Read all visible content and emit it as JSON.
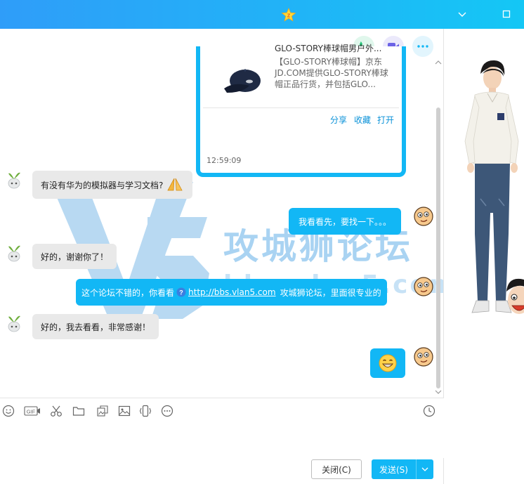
{
  "app": {
    "brand_color": "#12b7f5",
    "title_icon": "qq-zone-star-icon"
  },
  "titlebar": {
    "controls": [
      "chevron-down-icon",
      "maximize-icon"
    ]
  },
  "header_actions": [
    {
      "name": "phone-call-button",
      "icon": "phone-icon",
      "color": "#20c97a"
    },
    {
      "name": "video-call-button",
      "icon": "video-camera-icon",
      "color": "#6c63e6"
    },
    {
      "name": "more-button",
      "icon": "more-dots-icon",
      "color": "#12b7f5"
    }
  ],
  "card": {
    "title": "GLO-STORY棒球帽男户外...",
    "description_lines": [
      "【GLO-STORY棒球帽】京东",
      "JD.COM提供GLO-STORY棒球",
      "帽正品行货，并包括GLO..."
    ],
    "actions": [
      "分享",
      "收藏",
      "打开"
    ]
  },
  "timestamp": "12:59:09",
  "messages": [
    {
      "side": "left",
      "text": "有没有华为的模拟器与学习文档?",
      "emoji": "prayer-hands-icon"
    },
    {
      "side": "right",
      "text": "我看看先，要找一下。。。"
    },
    {
      "side": "left",
      "text": "好的，谢谢你了！"
    },
    {
      "side": "right",
      "text_before": "这个论坛不错的，你看看",
      "link": "http://bbs.vlan5.com",
      "text_after": "攻城狮论坛，里面很专业的"
    },
    {
      "side": "left",
      "text": "好的，我去看看，非常感谢！"
    },
    {
      "side": "right",
      "emoji": "grin-face-icon"
    }
  ],
  "watermark": {
    "text": "攻城狮论坛",
    "url": "bbs.vlan5.com"
  },
  "toolbar_icons": [
    "emoji-icon",
    "gif-icon",
    "scissors-icon",
    "folder-icon",
    "image-grid-icon",
    "image-icon",
    "shake-icon",
    "more-circle-icon",
    "history-clock-icon"
  ],
  "footer": {
    "close_label": "关闭(C)",
    "send_label": "发送(S)"
  }
}
